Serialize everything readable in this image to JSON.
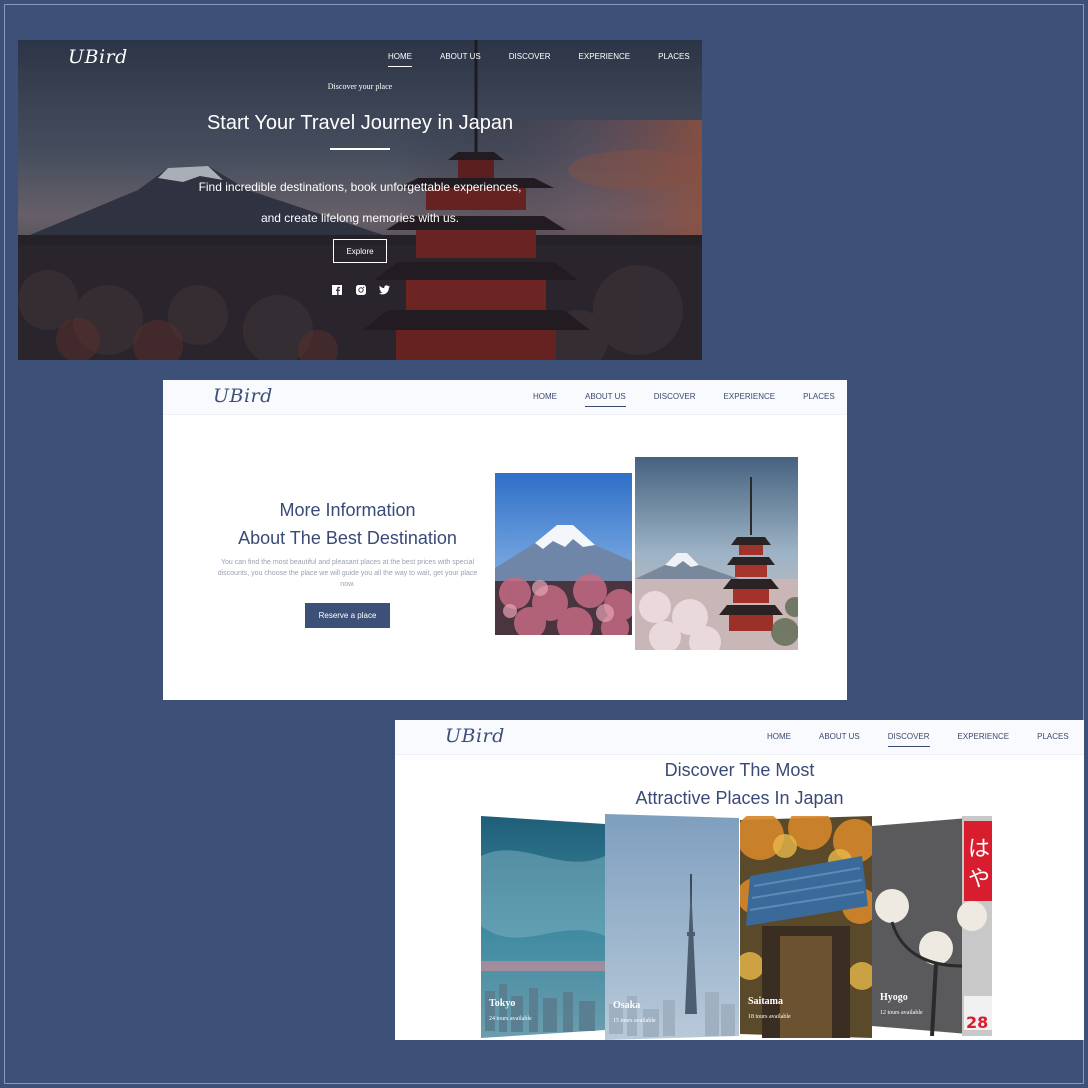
{
  "brand": {
    "logo": "UBird"
  },
  "nav_items": [
    "HOME",
    "ABOUT US",
    "DISCOVER",
    "EXPERIENCE",
    "PLACES"
  ],
  "hero": {
    "kicker": "Discover your place",
    "title_start": "Start Your ",
    "title_bold": "Travel Journey",
    "title_end": " in Japan",
    "description_line1": "Find incredible destinations, book unforgettable experiences,",
    "description_line2": "and create lifelong memories with us.",
    "cta_label": "Explore",
    "active_nav": "HOME"
  },
  "about": {
    "title_line1": "More Information",
    "title_line2": "About The Best Destination",
    "description": "You can find the most beautiful and pleasant places at the best prices with special discounts, you choose the place we will guide you all the way to wait, get your place now.",
    "cta_label": "Reserve a place",
    "active_nav": "ABOUT US"
  },
  "discover": {
    "title_line1": "Discover The Most",
    "title_line2": "Attractive Places In Japan",
    "active_nav": "DISCOVER",
    "cards": [
      {
        "name": "Tokyo",
        "tours": "24 tours available"
      },
      {
        "name": "Osaka",
        "tours": "15 tours available"
      },
      {
        "name": "Saitama",
        "tours": "18 tours available"
      },
      {
        "name": "Hyogo",
        "tours": "12 tours available"
      }
    ]
  },
  "colors": {
    "brand_navy": "#3d5078",
    "text_navy": "#3a4a78",
    "white": "#ffffff"
  },
  "icons": [
    "facebook-icon",
    "instagram-icon",
    "twitter-icon"
  ]
}
